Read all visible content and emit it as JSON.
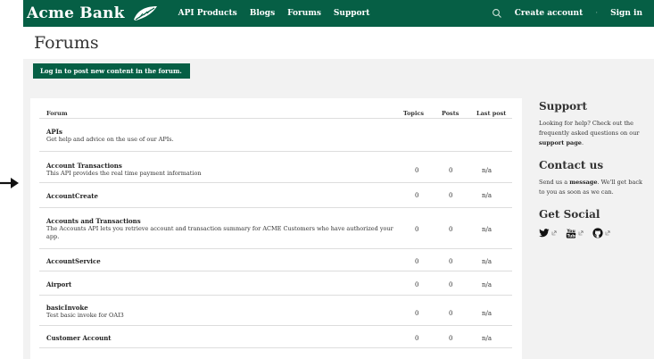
{
  "header": {
    "logo_text": "Acme Bank",
    "nav": [
      "API Products",
      "Blogs",
      "Forums",
      "Support"
    ],
    "create_account": "Create account",
    "sign_in": "Sign in",
    "separator": "·",
    "brand_color": "#065f45"
  },
  "page": {
    "title": "Forums",
    "login_banner": "Log in to post new content in the forum."
  },
  "table": {
    "headers": {
      "forum": "Forum",
      "topics": "Topics",
      "posts": "Posts",
      "last_post": "Last post"
    },
    "rows": [
      {
        "title": "APIs",
        "desc": "Get help and advice on the use of our APIs.",
        "topics": "",
        "posts": "",
        "last": ""
      },
      {
        "title": "Account Transactions",
        "desc": "This API provides the real time payment information",
        "topics": "0",
        "posts": "0",
        "last": "n/a"
      },
      {
        "title": "AccountCreate",
        "desc": "",
        "topics": "0",
        "posts": "0",
        "last": "n/a"
      },
      {
        "title": "Accounts and Transactions",
        "desc": "The Accounts API lets you retrieve account and transaction summary for ACME Customers who have authorized your app.",
        "topics": "0",
        "posts": "0",
        "last": "n/a"
      },
      {
        "title": "AccountService",
        "desc": "",
        "topics": "0",
        "posts": "0",
        "last": "n/a"
      },
      {
        "title": "Airport",
        "desc": "",
        "topics": "0",
        "posts": "0",
        "last": "n/a"
      },
      {
        "title": "basicInvoke",
        "desc": "Test basic invoke for OAI3",
        "topics": "0",
        "posts": "0",
        "last": "n/a"
      },
      {
        "title": "Customer Account",
        "desc": "",
        "topics": "0",
        "posts": "0",
        "last": "n/a"
      }
    ]
  },
  "sidebar": {
    "support_title": "Support",
    "support_text_1": "Looking for help? Check out the frequently asked questions on our",
    "support_link": "support page",
    "support_text_2": ".",
    "contact_title": "Contact us",
    "contact_text_1": "Send us a",
    "contact_link": "message",
    "contact_text_2": ". We'll get back to you as soon as we can.",
    "social_title": "Get Social",
    "social_icons": [
      "twitter-icon",
      "youtube-icon",
      "github-icon"
    ]
  }
}
